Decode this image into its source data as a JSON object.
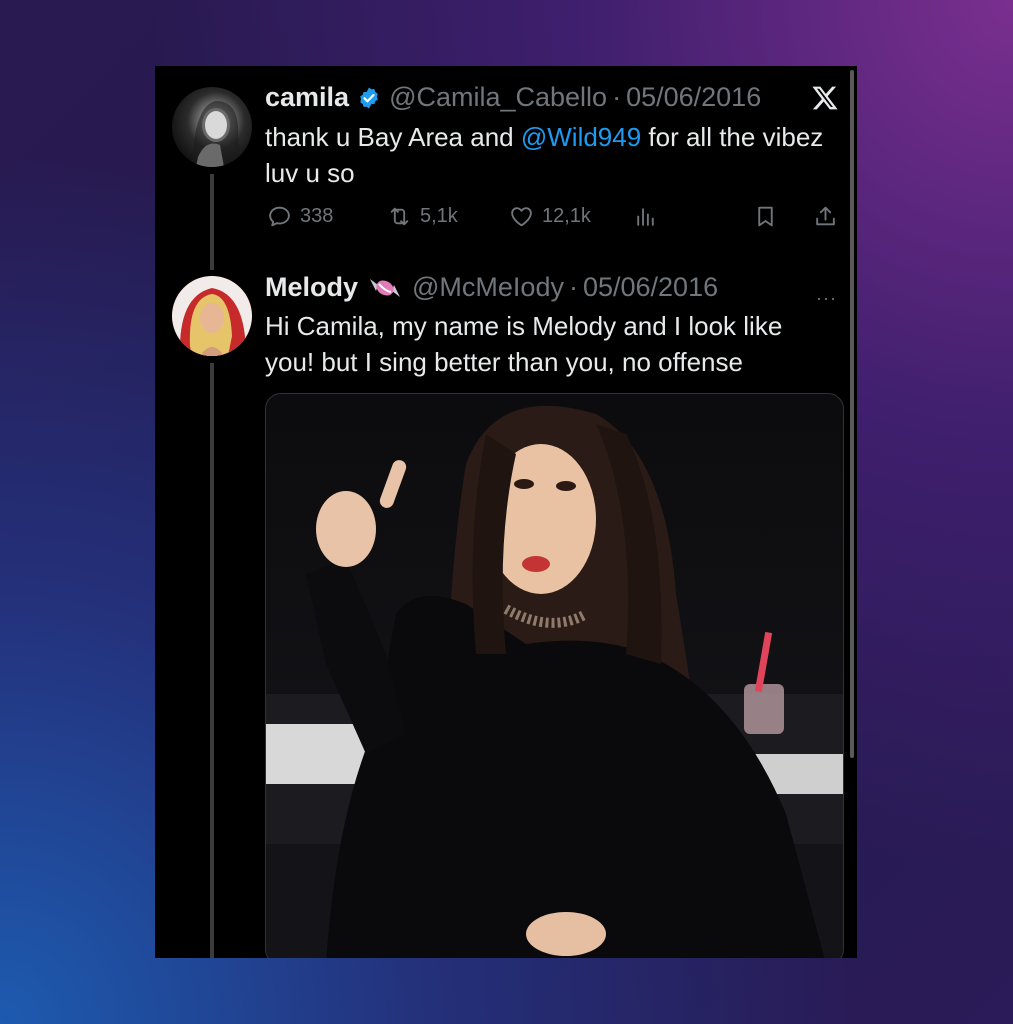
{
  "app": {
    "logo": "x-logo-icon"
  },
  "original_tweet": {
    "name": "camila",
    "verified": true,
    "handle": "@Camila_Cabello",
    "separator": "·",
    "date": "05/06/2016",
    "text_before": "thank u Bay Area and ",
    "mention": "@Wild949",
    "text_after": " for all the vibez luv u so",
    "stats": {
      "replies": "338",
      "reposts": "5,1k",
      "likes": "12,1k"
    }
  },
  "reply_tweet": {
    "name": "Melody",
    "emoji": "candy",
    "handle": "@McMeIody",
    "separator": "·",
    "date": "05/06/2016",
    "text": "Hi Camila, my name is Melody and I look like you! but I sing better than you, no offense",
    "more": "···",
    "has_media": true
  },
  "colors": {
    "background": "#000000",
    "text": "#e7e9ea",
    "secondary": "#71767b",
    "link": "#1d9bf0",
    "verified": "#1d9bf0"
  }
}
